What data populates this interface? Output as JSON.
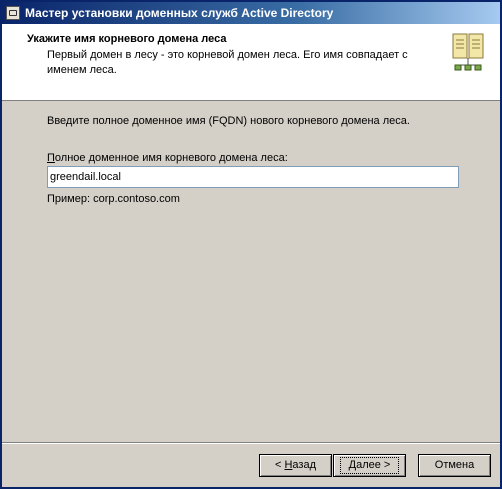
{
  "window": {
    "title": "Мастер установки доменных служб Active Directory"
  },
  "header": {
    "title": "Укажите имя корневого домена леса",
    "subtitle": "Первый домен в лесу - это корневой домен леса. Его имя совпадает с именем леса."
  },
  "main": {
    "prompt": "Введите полное доменное имя (FQDN) нового корневого домена леса.",
    "field_label_prefix": "П",
    "field_label_rest": "олное доменное имя корневого домена леса:",
    "field_value": "greendail.local",
    "example": "Пример: corp.contoso.com"
  },
  "buttons": {
    "back_prefix": "< ",
    "back_accel": "Н",
    "back_rest": "азад",
    "next_accel": "Д",
    "next_rest": "алее >",
    "cancel": "Отмена"
  },
  "icons": {
    "title": "wizard-app-icon",
    "header": "directory-book-icon"
  }
}
